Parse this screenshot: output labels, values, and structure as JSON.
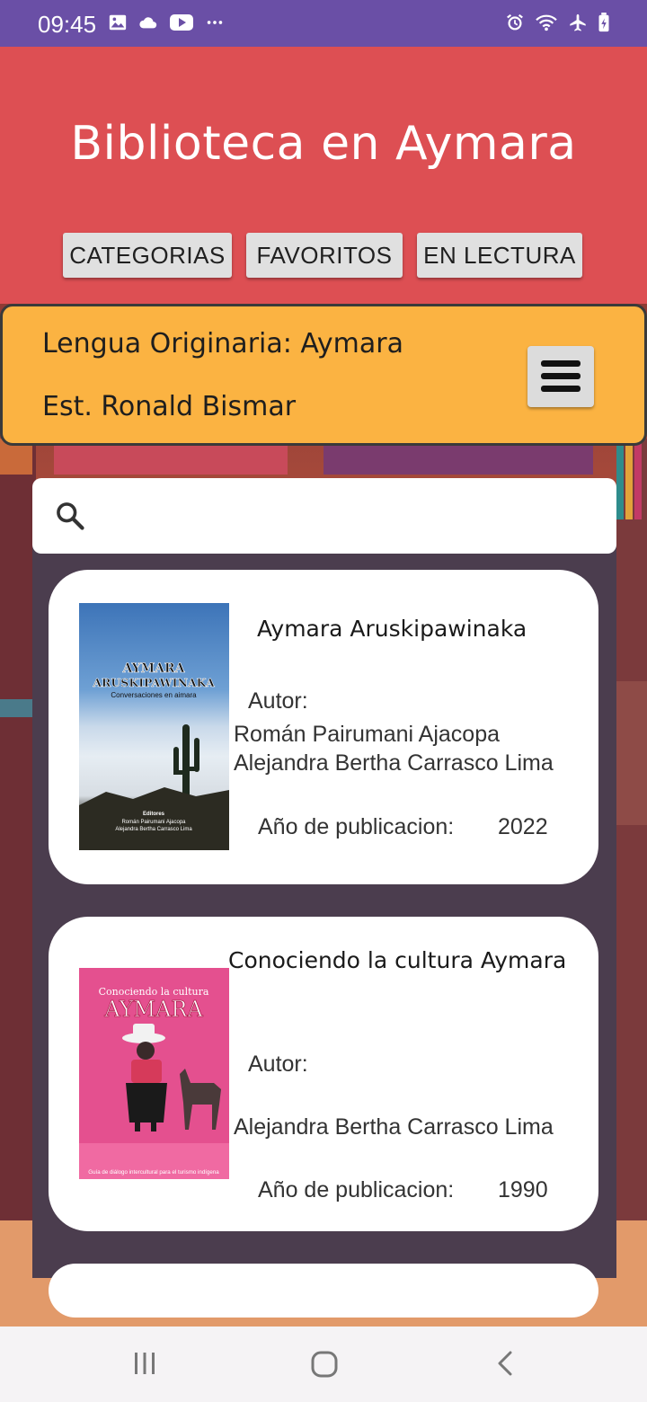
{
  "status_bar": {
    "time": "09:45",
    "left_icons": [
      "image-icon",
      "cloud-icon",
      "youtube-icon",
      "more-dots-icon"
    ],
    "right_icons": [
      "alarm-icon",
      "wifi-icon",
      "airplane-icon",
      "battery-icon"
    ],
    "background": "#6a4fa6"
  },
  "header": {
    "title": "Biblioteca en Aymara",
    "background": "#dd4f53",
    "buttons": {
      "categorias": "CATEGORIAS",
      "favoritos": "FAVORITOS",
      "en_lectura": "EN LECTURA"
    }
  },
  "info_bar": {
    "line1": "Lengua Originaria: Aymara",
    "line2": "Est. Ronald Bismar",
    "background": "#fbb342",
    "menu_icon": "hamburger-menu-icon"
  },
  "search": {
    "icon": "search-icon",
    "value": "",
    "placeholder": ""
  },
  "books": [
    {
      "title": "Aymara Aruskipawinaka",
      "author_label": "Autor:",
      "authors": [
        "Román Pairumani Ajacopa",
        "Alejandra Bertha Carrasco Lima"
      ],
      "year_label": "Año de publicacion:",
      "year": "2022",
      "cover_text": {
        "line1": "AYMARA",
        "line2": "ARUSKIPAWINAKA",
        "subtitle": "Conversaciones en aimara",
        "credits_heading": "Editores",
        "credit1": "Román Pairumani Ajacopa",
        "credit2": "Alejandra Bertha Carrasco Lima"
      }
    },
    {
      "title": "Conociendo la cultura Aymara",
      "author_label": "Autor:",
      "authors": [
        "Alejandra Bertha Carrasco Lima"
      ],
      "year_label": "Año de publicacion:",
      "year": "1990",
      "cover_text": {
        "line1": "Conociendo la cultura",
        "line2": "AYMARA",
        "footer": "Guía de diálogo intercultural para el turismo indígena"
      }
    }
  ],
  "nav_bar": {
    "icons": [
      "recent-apps-icon",
      "home-icon",
      "back-icon"
    ]
  }
}
